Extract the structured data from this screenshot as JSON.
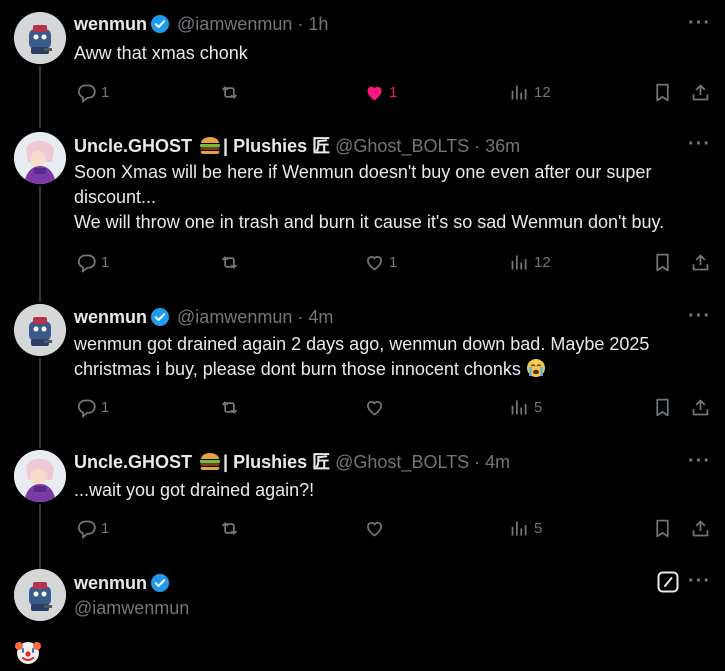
{
  "tweets": [
    {
      "name": "wenmun",
      "handle": "@iamwenmun",
      "time": "· 1h",
      "lines": [
        "Aww that xmas chonk"
      ],
      "replies": "1",
      "likes": "1",
      "views": "12"
    },
    {
      "name": "Uncle.GHOST",
      "name_suffix": "| Plushies 匠",
      "handle": "@Ghost_BOLTS",
      "time": "· 36m",
      "lines": [
        "Soon Xmas will be here if Wenmun doesn't buy one even after our super",
        "discount...",
        "We will throw one in trash and burn it cause it's so sad Wenmun don't buy."
      ],
      "replies": "1",
      "likes": "1",
      "views": "12"
    },
    {
      "name": "wenmun",
      "handle": "@iamwenmun",
      "time": "· 4m",
      "lines": [
        "wenmun got drained again 2 days ago, wenmun down bad. Maybe 2025",
        "christmas i buy, please dont burn those innocent chonks"
      ],
      "replies": "1",
      "views": "5"
    },
    {
      "name": "Uncle.GHOST",
      "name_suffix": "| Plushies 匠",
      "handle": "@Ghost_BOLTS",
      "time": "· 4m",
      "lines": [
        "...wait you got drained again?!"
      ],
      "replies": "1",
      "views": "5"
    }
  ],
  "composer": {
    "name": "wenmun",
    "handle": "@iamwenmun"
  },
  "more_label": "···",
  "colors": {
    "accent": "#1d9bf0",
    "like": "#f91880",
    "muted": "#71767b"
  }
}
